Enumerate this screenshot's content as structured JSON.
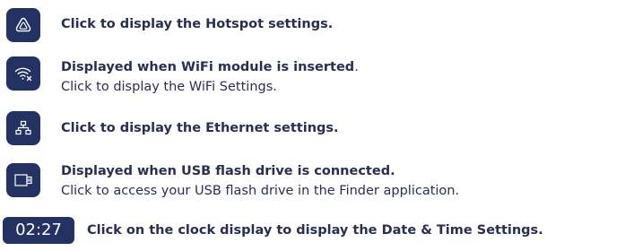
{
  "rows": [
    {
      "icon": "hotspot-icon",
      "bold": "Click to display the Hotspot settings.",
      "bold_suffix": "",
      "line2": ""
    },
    {
      "icon": "wifi-module-icon",
      "bold": "Displayed when WiFi module is inserted",
      "bold_suffix": ".",
      "line2": "Click to display the WiFi Settings."
    },
    {
      "icon": "ethernet-icon",
      "bold": "Click to display the Ethernet settings.",
      "bold_suffix": "",
      "line2": ""
    },
    {
      "icon": "usb-drive-icon",
      "bold": "Displayed when USB flash drive is connected.",
      "bold_suffix": "",
      "line2": "Click to access your USB flash drive in the Finder application."
    }
  ],
  "clock": {
    "time": "02:27",
    "description": "Click on the clock display to display the Date & Time Settings."
  },
  "colors": {
    "button_bg": "#233262",
    "icon_fg": "#ffffff",
    "text": "#2a2f52"
  }
}
